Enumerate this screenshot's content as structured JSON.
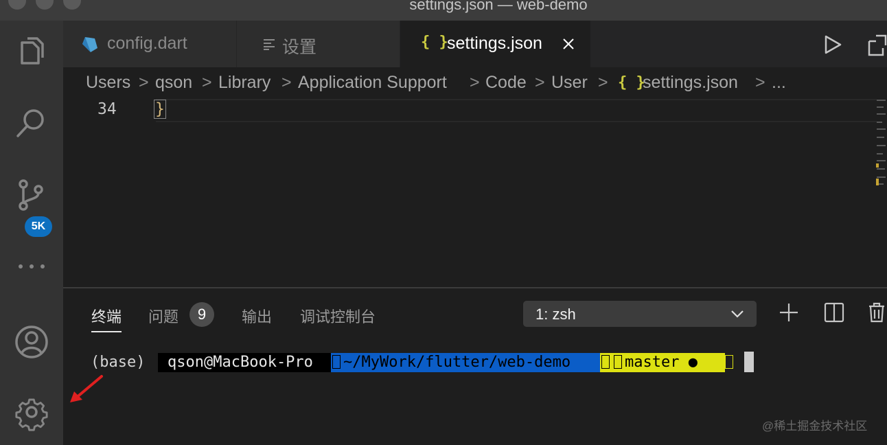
{
  "window": {
    "title": "settings.json — web-demo"
  },
  "activity_bar": {
    "items": [
      {
        "icon": "files-icon"
      },
      {
        "icon": "search-icon"
      },
      {
        "icon": "source-control-icon",
        "badge": "5K"
      },
      {
        "icon": "more-icon"
      }
    ],
    "bottom": [
      {
        "icon": "account-icon"
      },
      {
        "icon": "gear-icon"
      }
    ]
  },
  "tabs": [
    {
      "label": "config.dart",
      "icon": "dart-icon"
    },
    {
      "label": "设置",
      "icon": "settings-list-icon"
    },
    {
      "label": "settings.json",
      "icon": "json-icon",
      "icon_text": "{ }",
      "active": true
    }
  ],
  "breadcrumb": {
    "items": [
      "Users",
      "qson",
      "Library",
      "Application Support",
      "Code",
      "User",
      "settings.json",
      "..."
    ],
    "separator": ">",
    "file_icon_text": "{ }"
  },
  "editor": {
    "line_number": "34",
    "code": "}"
  },
  "panel": {
    "tabs": [
      {
        "label": "终端",
        "active": true
      },
      {
        "label": "问题",
        "count": "9"
      },
      {
        "label": "输出"
      },
      {
        "label": "调试控制台"
      }
    ],
    "terminal_select": "1: zsh"
  },
  "terminal": {
    "env": "(base)",
    "user_host": "qson@MacBook-Pro",
    "path": "~/MyWork/flutter/web-demo",
    "branch": "master",
    "dirty_mark": "●"
  },
  "watermark": "@稀土掘金技术社区",
  "colors": {
    "activity_bar": "#333333",
    "editor_bg": "#1e1e1e",
    "badge": "#0e70c0",
    "json_brace": "#cbcb41",
    "prompt_dir": "#0b5dc7",
    "prompt_git": "#dde112",
    "annotation_arrow": "#e02020"
  }
}
